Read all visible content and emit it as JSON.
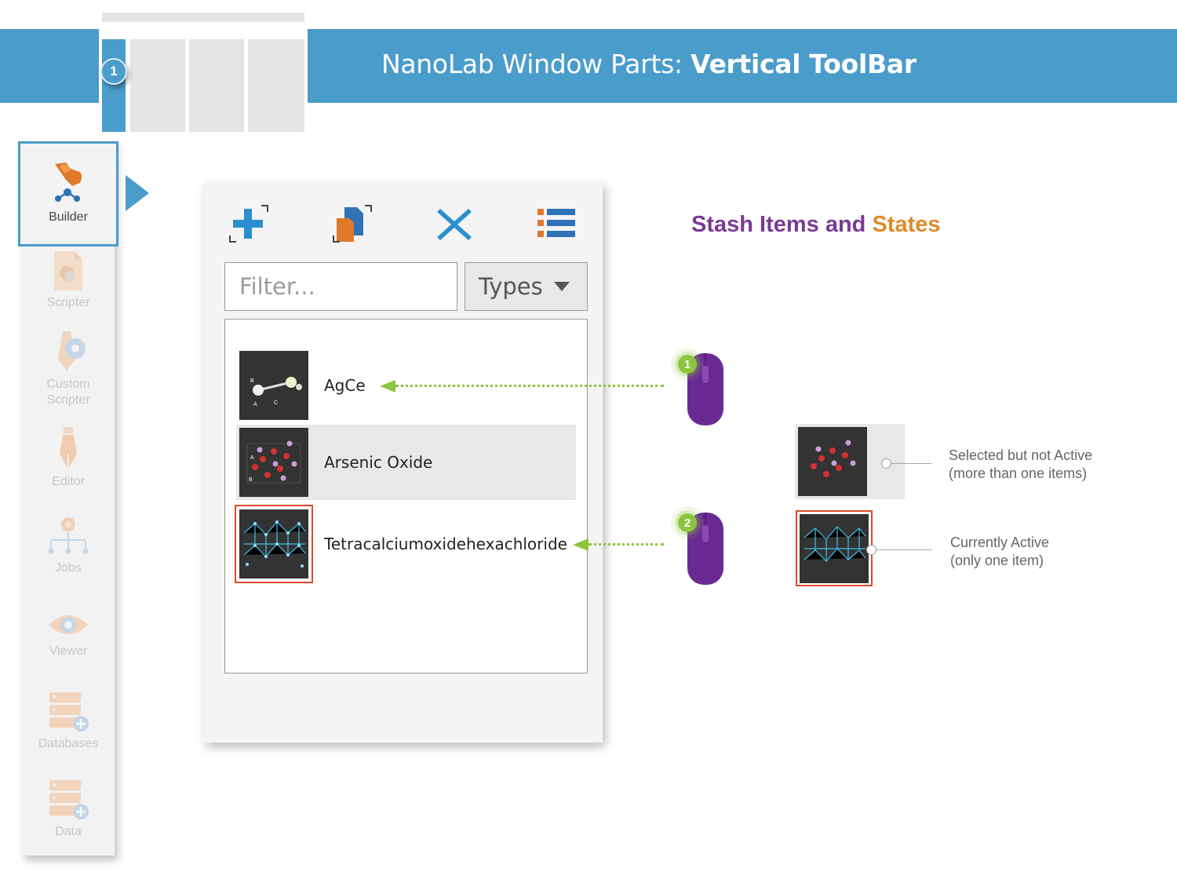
{
  "header": {
    "title_prefix": "NanoLab Window Parts: ",
    "title_bold": "Vertical ToolBar",
    "window_part_badge": "1"
  },
  "toolbar": {
    "items": [
      {
        "label": "Builder",
        "icon": "builder-icon",
        "active": true
      },
      {
        "label": "Scripter",
        "icon": "python-script-icon"
      },
      {
        "label": "Custom\nScripter",
        "icon": "custom-scripter-icon"
      },
      {
        "label": "Editor",
        "icon": "pen-nib-icon"
      },
      {
        "label": "Jobs",
        "icon": "jobs-tree-icon"
      },
      {
        "label": "Viewer",
        "icon": "eye-icon"
      },
      {
        "label": "Databases",
        "icon": "database-add-icon"
      },
      {
        "label": "Data",
        "icon": "database-add-icon"
      }
    ]
  },
  "stash_panel": {
    "tools": [
      "add-icon",
      "duplicate-icon",
      "delete-icon",
      "list-view-icon"
    ],
    "filter_placeholder": "Filter...",
    "types_label": "Types",
    "items": [
      {
        "name": "AgCe",
        "state": "normal",
        "thumb_letters": [
          "B",
          "A",
          "C"
        ]
      },
      {
        "name": "Arsenic Oxide",
        "state": "selected",
        "thumb_letters": [
          "A",
          "B"
        ]
      },
      {
        "name": "Tetracalciumoxidehexachloride",
        "state": "active",
        "thumb_letters": []
      }
    ]
  },
  "annotations": {
    "section_title_part1": "Stash Items and ",
    "section_title_part2": "States",
    "click_badges": [
      "1",
      "2"
    ],
    "selected_line1": "Selected but not Active",
    "selected_line2": "(more than one items)",
    "active_line1": "Currently Active",
    "active_line2": "(only one item)"
  },
  "colors": {
    "accent_blue": "#4a9ccb",
    "purple": "#7a3a93",
    "orange": "#e08a2a",
    "green": "#8cc63f",
    "active_red": "#e04a2a"
  }
}
